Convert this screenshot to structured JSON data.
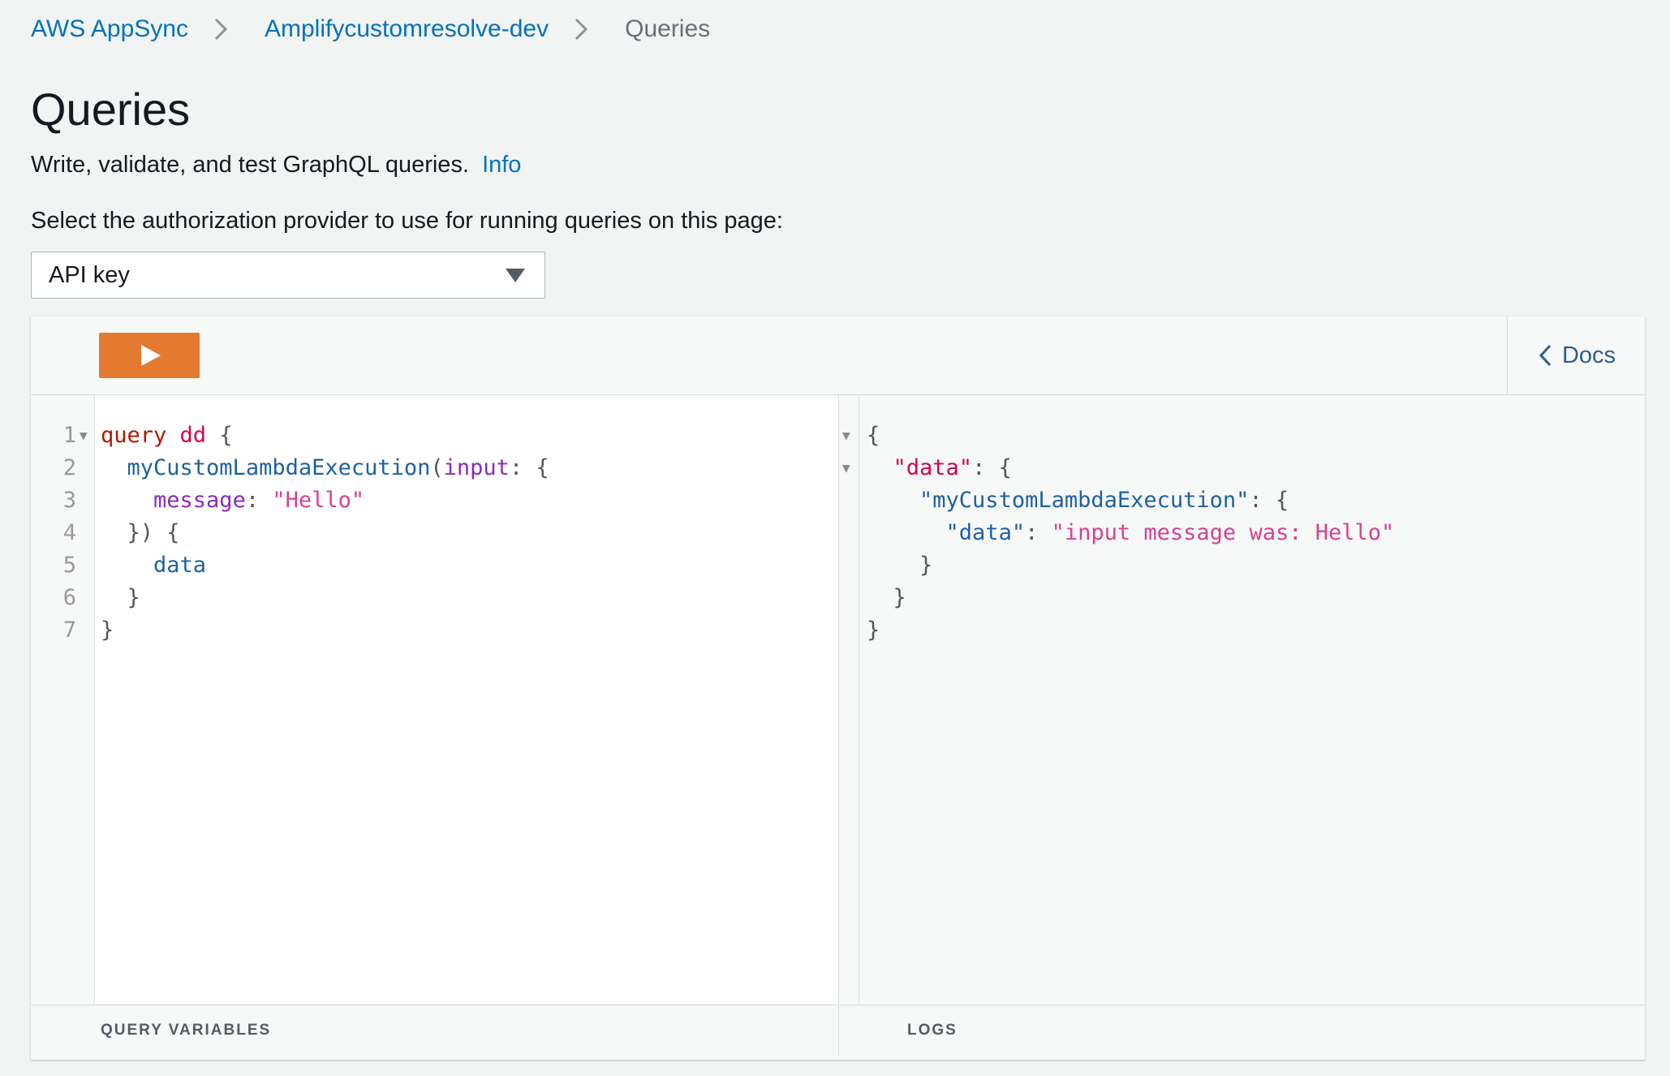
{
  "breadcrumb": {
    "items": [
      "AWS AppSync",
      "Amplifycustomresolve-dev"
    ],
    "current": "Queries"
  },
  "page": {
    "title": "Queries",
    "description": "Write, validate, and test GraphQL queries.",
    "info_link": "Info",
    "auth_label": "Select the authorization provider to use for running queries on this page:",
    "auth_selected": "API key"
  },
  "toolbar": {
    "run_icon": "play-icon",
    "docs_label": "Docs"
  },
  "query_editor": {
    "line_numbers": [
      "1",
      "2",
      "3",
      "4",
      "5",
      "6",
      "7"
    ],
    "tokens": {
      "query_kw": "query",
      "op_name": "dd",
      "open_brace": "{",
      "field": "myCustomLambdaExecution",
      "paren_open": "(",
      "arg": "input",
      "colon": ":",
      "arg_brace": "{",
      "message_key": "message",
      "message_val": "\"Hello\"",
      "close_args": "}) {",
      "data_field": "data",
      "close_inner": "}",
      "close_outer": "}"
    }
  },
  "result": {
    "l1": "{",
    "data_key": "\"data\"",
    "l2_rest": ": {",
    "exec_key": "\"myCustomLambdaExecution\"",
    "l3_rest": ": {",
    "inner_key": "\"data\"",
    "l4_colon": ": ",
    "inner_val": "\"input message was: Hello\"",
    "l5": "}",
    "l6": "}",
    "l7": "}"
  },
  "footer": {
    "query_variables": "QUERY VARIABLES",
    "logs": "LOGS"
  }
}
